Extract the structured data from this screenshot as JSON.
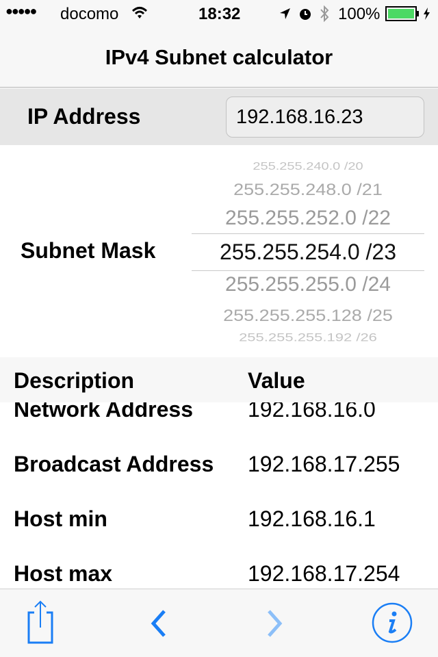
{
  "status": {
    "signal": "●●●●●",
    "carrier": "docomo",
    "time": "18:32",
    "battery": "100%"
  },
  "nav": {
    "title": "IPv4 Subnet calculator"
  },
  "ip": {
    "label": "IP Address",
    "value": "192.168.16.23"
  },
  "mask": {
    "label": "Subnet Mask",
    "options": [
      "255.255.240.0 /20",
      "255.255.248.0 /21",
      "255.255.252.0 /22",
      "255.255.254.0 /23",
      "255.255.255.0 /24",
      "255.255.255.128 /25",
      "255.255.255.192 /26"
    ],
    "selected": "255.255.254.0 /23"
  },
  "table": {
    "headers": [
      "Description",
      "Value"
    ],
    "rows": [
      {
        "d": "Network Address",
        "v": "192.168.16.0"
      },
      {
        "d": "Broadcast Address",
        "v": "192.168.17.255"
      },
      {
        "d": "Host min",
        "v": "192.168.16.1"
      },
      {
        "d": "Host max",
        "v": "192.168.17.254"
      }
    ]
  },
  "toolbar": {
    "icons": [
      "share-icon",
      "chevron-left-icon",
      "chevron-right-icon",
      "info-icon"
    ]
  },
  "colors": {
    "accent": "#1a7ef5",
    "battery": "#4cd964"
  }
}
